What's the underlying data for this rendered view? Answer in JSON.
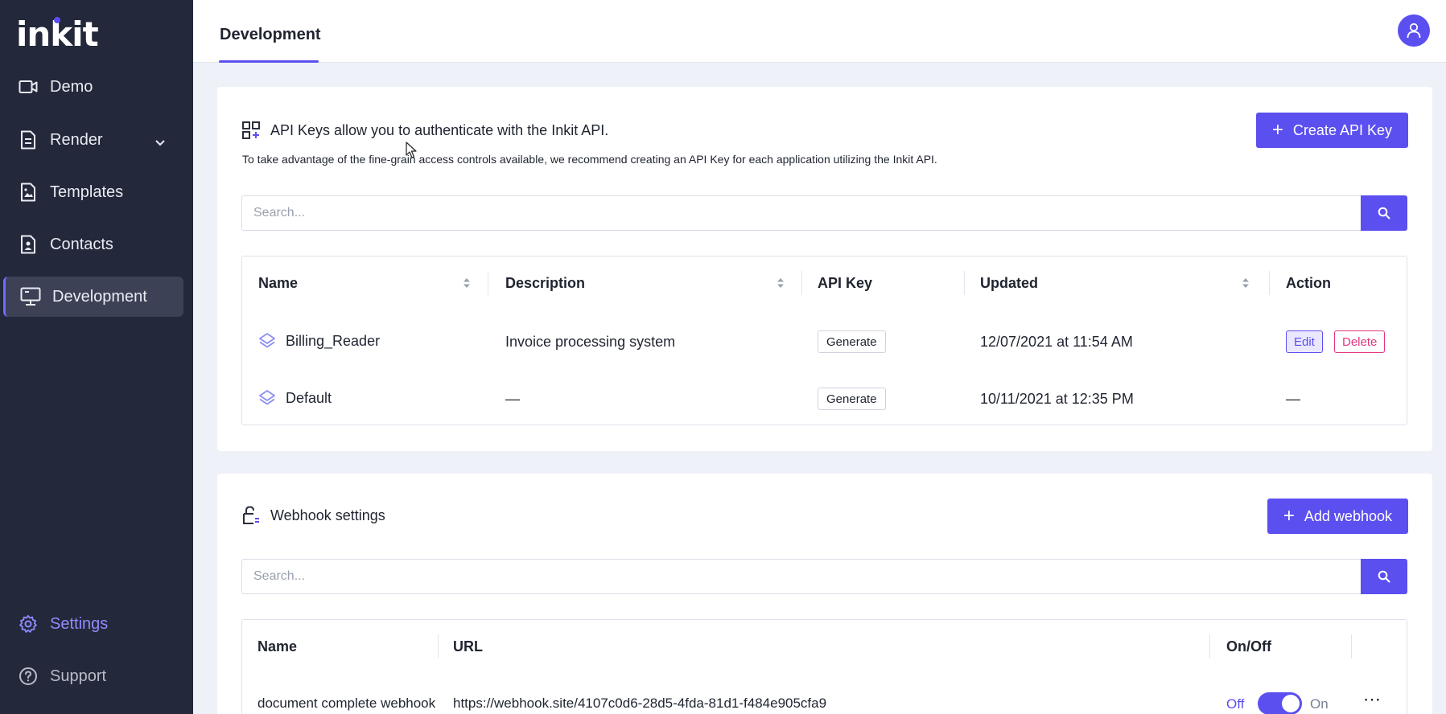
{
  "app": {
    "logo": "inkit"
  },
  "sidebar": {
    "items": [
      {
        "label": "Demo",
        "icon": "video-camera-icon"
      },
      {
        "label": "Render",
        "icon": "document-icon"
      },
      {
        "label": "Templates",
        "icon": "image-file-icon"
      },
      {
        "label": "Contacts",
        "icon": "contact-file-icon"
      },
      {
        "label": "Development",
        "icon": "monitor-icon"
      }
    ],
    "settings_label": "Settings",
    "support_label": "Support"
  },
  "header": {
    "tab": "Development"
  },
  "api_keys": {
    "heading": "API Keys allow you to authenticate with the Inkit API.",
    "description": "To take advantage of the fine-grain access controls available, we recommend creating an API Key for each application utilizing the Inkit API.",
    "create_label": "Create API Key",
    "search_placeholder": "Search...",
    "columns": {
      "name": "Name",
      "description": "Description",
      "api_key": "API Key",
      "updated": "Updated",
      "action": "Action"
    },
    "rows": [
      {
        "name": "Billing_Reader",
        "description": "Invoice processing system",
        "api_key_action": "Generate",
        "updated": "12/07/2021 at 11:54 AM",
        "edit": "Edit",
        "delete": "Delete"
      },
      {
        "name": "Default",
        "description": "—",
        "api_key_action": "Generate",
        "updated": "10/11/2021 at 12:35 PM",
        "action_placeholder": "—"
      }
    ]
  },
  "webhooks": {
    "heading": "Webhook settings",
    "add_label": "Add webhook",
    "search_placeholder": "Search...",
    "columns": {
      "name": "Name",
      "url": "URL",
      "onoff": "On/Off"
    },
    "rows": [
      {
        "name": "document complete webhook",
        "url": "https://webhook.site/4107c0d6-28d5-4fda-81d1-f484e905cfa9",
        "off_label": "Off",
        "on_label": "On",
        "enabled": true
      }
    ]
  },
  "colors": {
    "accent": "#5b4ff0",
    "sidebar": "#23283a",
    "danger": "#e2367e"
  }
}
